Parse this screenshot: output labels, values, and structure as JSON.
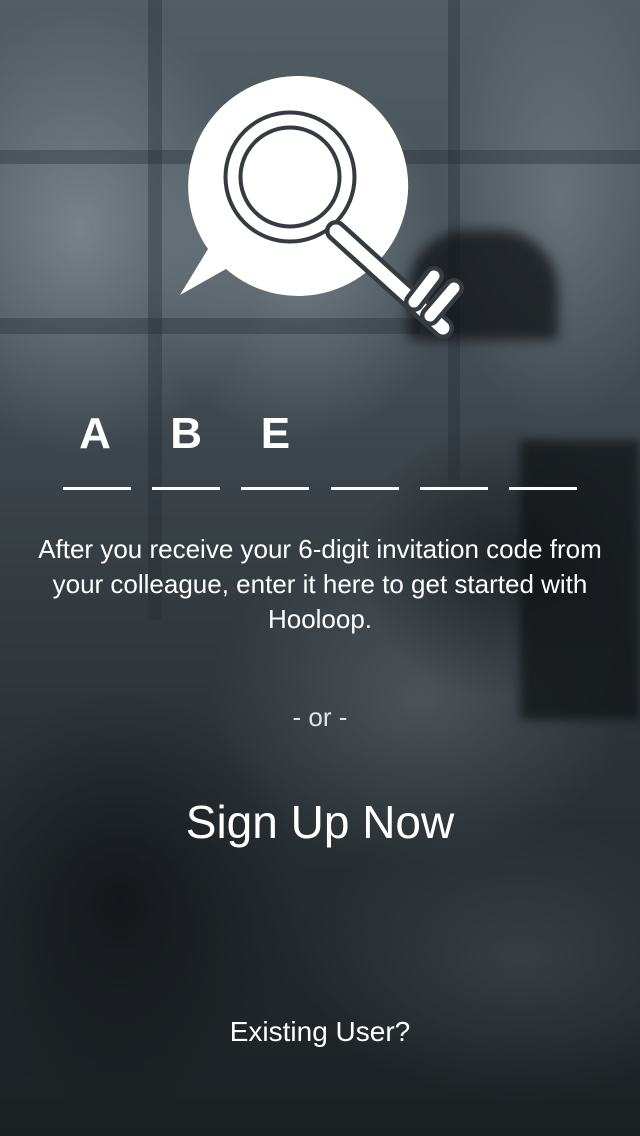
{
  "app": {
    "name": "Hooloop"
  },
  "logo": {
    "icon": "speech-bubble-magnifier-key-icon",
    "color": "#ffffff"
  },
  "invitation_code": {
    "length": 6,
    "slots": [
      "A",
      "B",
      "E",
      "",
      "",
      ""
    ]
  },
  "instructions": "After you receive your 6-digit invitation code from your colleague, enter it here to get started with Hooloop.",
  "divider": "- or -",
  "actions": {
    "signup_label": "Sign Up Now",
    "existing_user_label": "Existing User?"
  },
  "colors": {
    "text": "#ffffff",
    "overlay": "#2b3236"
  }
}
